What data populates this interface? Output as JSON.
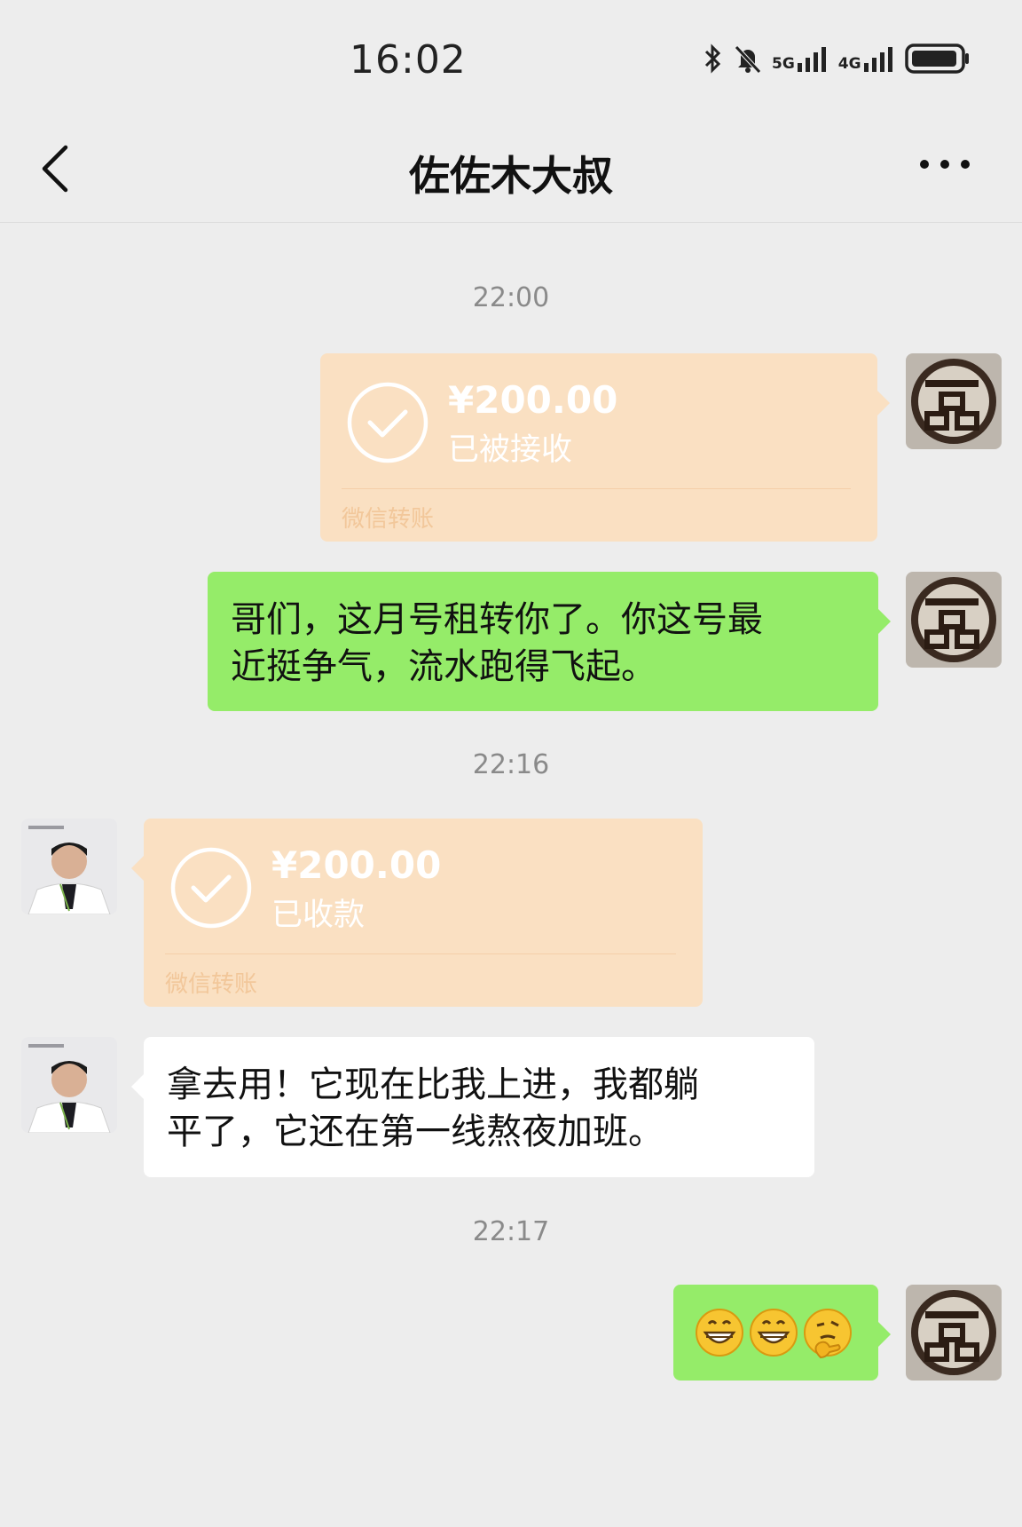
{
  "status_bar": {
    "time": "16:02",
    "icons": [
      "bluetooth-icon",
      "mute-bell-icon",
      "signal-5g-icon",
      "signal-4g-icon",
      "battery-icon"
    ],
    "net1": "5G",
    "net2": "4G"
  },
  "header": {
    "title": "佐佐木大叔",
    "back_icon": "chevron-left-icon",
    "more_icon": "more-dots-icon"
  },
  "colors": {
    "background": "#ededed",
    "self_bubble": "#95ec69",
    "other_bubble": "#ffffff",
    "transfer_card": "#fae0c2"
  },
  "messages": [
    {
      "type": "timestamp",
      "text": "22:00"
    },
    {
      "type": "transfer",
      "side": "right",
      "amount": "¥200.00",
      "status": "已被接收",
      "footer": "微信转账"
    },
    {
      "type": "text",
      "side": "right",
      "lines": [
        "哥们，这月号租转你了。你这号最",
        "近挺争气，流水跑得飞起。"
      ]
    },
    {
      "type": "timestamp",
      "text": "22:16"
    },
    {
      "type": "transfer",
      "side": "left",
      "amount": "¥200.00",
      "status": "已收款",
      "footer": "微信转账"
    },
    {
      "type": "text",
      "side": "left",
      "lines": [
        "拿去用！它现在比我上进，我都躺",
        "平了，它还在第一线熬夜加班。"
      ]
    },
    {
      "type": "timestamp",
      "text": "22:17"
    },
    {
      "type": "emoji",
      "side": "right",
      "emojis": [
        "grin-emoji",
        "grin-emoji",
        "thinking-emoji"
      ]
    }
  ]
}
